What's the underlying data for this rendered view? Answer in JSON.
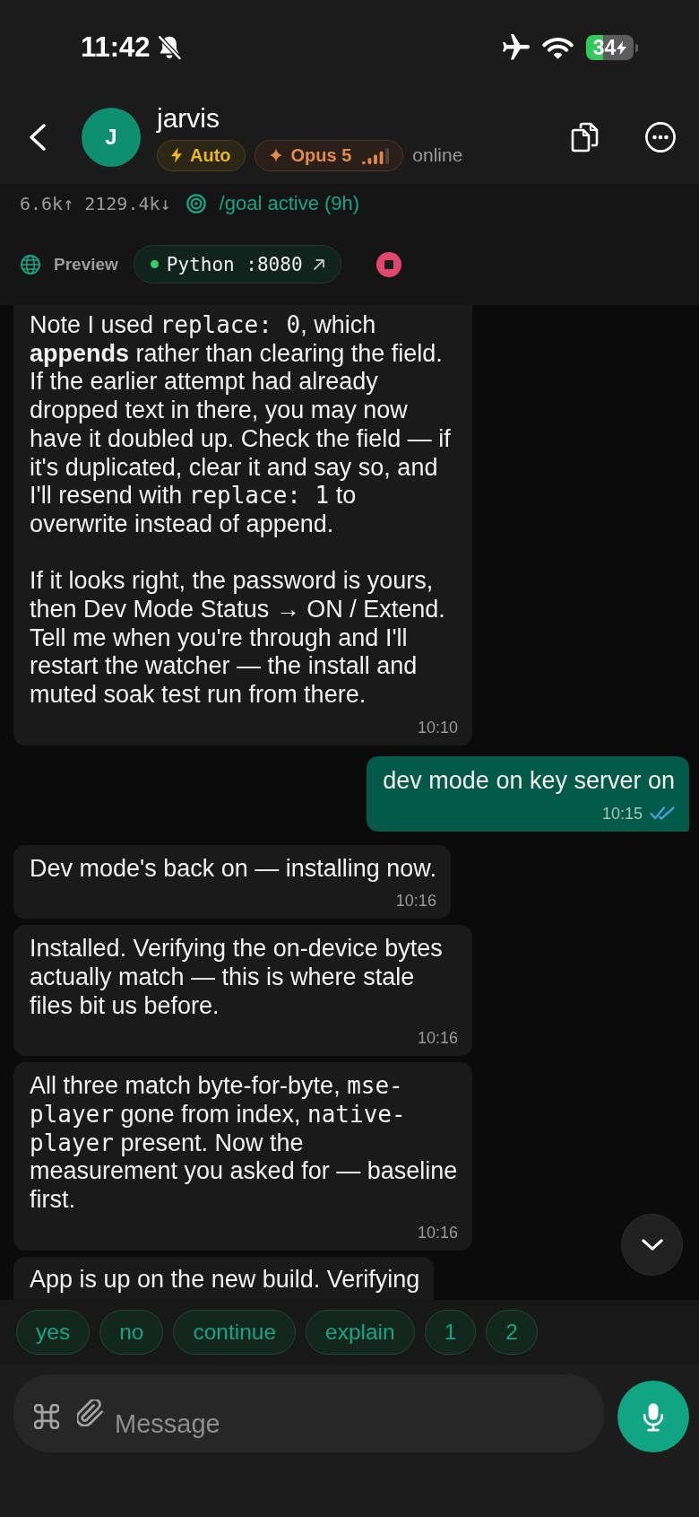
{
  "status_bar": {
    "time": "11:42",
    "silent": true,
    "airplane_mode": true,
    "battery": "34",
    "charging": true
  },
  "header": {
    "avatar": "J",
    "title": "jarvis",
    "badges": [
      {
        "kind": "mode",
        "label": "Auto"
      },
      {
        "kind": "model",
        "label": "Opus 5",
        "level": 0.8
      }
    ],
    "presence": "online"
  },
  "stats": {
    "usage": "6.6k↑ 2129.4k↓",
    "goal": "/goal active (9h)"
  },
  "preview": {
    "label": "Preview",
    "server": "Python :8080",
    "running": true
  },
  "messages": [
    {
      "kind": "incoming",
      "paragraphs": [
        [
          {
            "kind": "text",
            "text": "Note I used "
          },
          {
            "kind": "code",
            "text": "replace: 0"
          },
          {
            "kind": "text",
            "text": ", which **appends** rather than clearing the field. If the earlier attempt had already dropped text in there, you may now have it doubled up. Check the field — if it's duplicated, clear it and say so, and I'll resend with "
          },
          {
            "kind": "code",
            "text": "replace: 1"
          },
          {
            "kind": "text",
            "text": " to overwrite instead of append."
          }
        ],
        [
          {
            "kind": "text",
            "text": "If it looks right, the password is yours, then Dev Mode Status → ON / Extend. Tell me when you're through and I'll restart the watcher — the install and muted soak test run from there."
          }
        ]
      ],
      "time": "10:10"
    },
    {
      "kind": "outgoing",
      "paragraphs": [
        [
          {
            "kind": "text",
            "text": "dev mode on key server on"
          }
        ]
      ],
      "time": "10:15",
      "read": true
    },
    {
      "kind": "incoming",
      "paragraphs": [
        [
          {
            "kind": "text",
            "text": "Dev mode's back on — installing now."
          }
        ]
      ],
      "time": "10:16"
    },
    {
      "kind": "incoming",
      "paragraphs": [
        [
          {
            "kind": "text",
            "text": "Installed. Verifying the on-device bytes actually match — this is where stale files bit us before."
          }
        ]
      ],
      "time": "10:16"
    },
    {
      "kind": "incoming",
      "paragraphs": [
        [
          {
            "kind": "text",
            "text": "All three match byte-for-byte, "
          },
          {
            "kind": "code",
            "text": "mse-player"
          },
          {
            "kind": "text",
            "text": " gone from index, "
          },
          {
            "kind": "code",
            "text": "native-player"
          },
          {
            "kind": "text",
            "text": " present. Now the measurement you asked for — baseline first."
          }
        ]
      ],
      "time": "10:16"
    },
    {
      "kind": "incoming",
      "paragraphs": [
        [
          {
            "kind": "text",
            "text": "App is up on the new build. Verifying"
          }
        ]
      ]
    }
  ],
  "quick_replies": [
    "yes",
    "no",
    "continue",
    "explain",
    "1",
    "2"
  ],
  "composer": {
    "placeholder": "Message"
  }
}
